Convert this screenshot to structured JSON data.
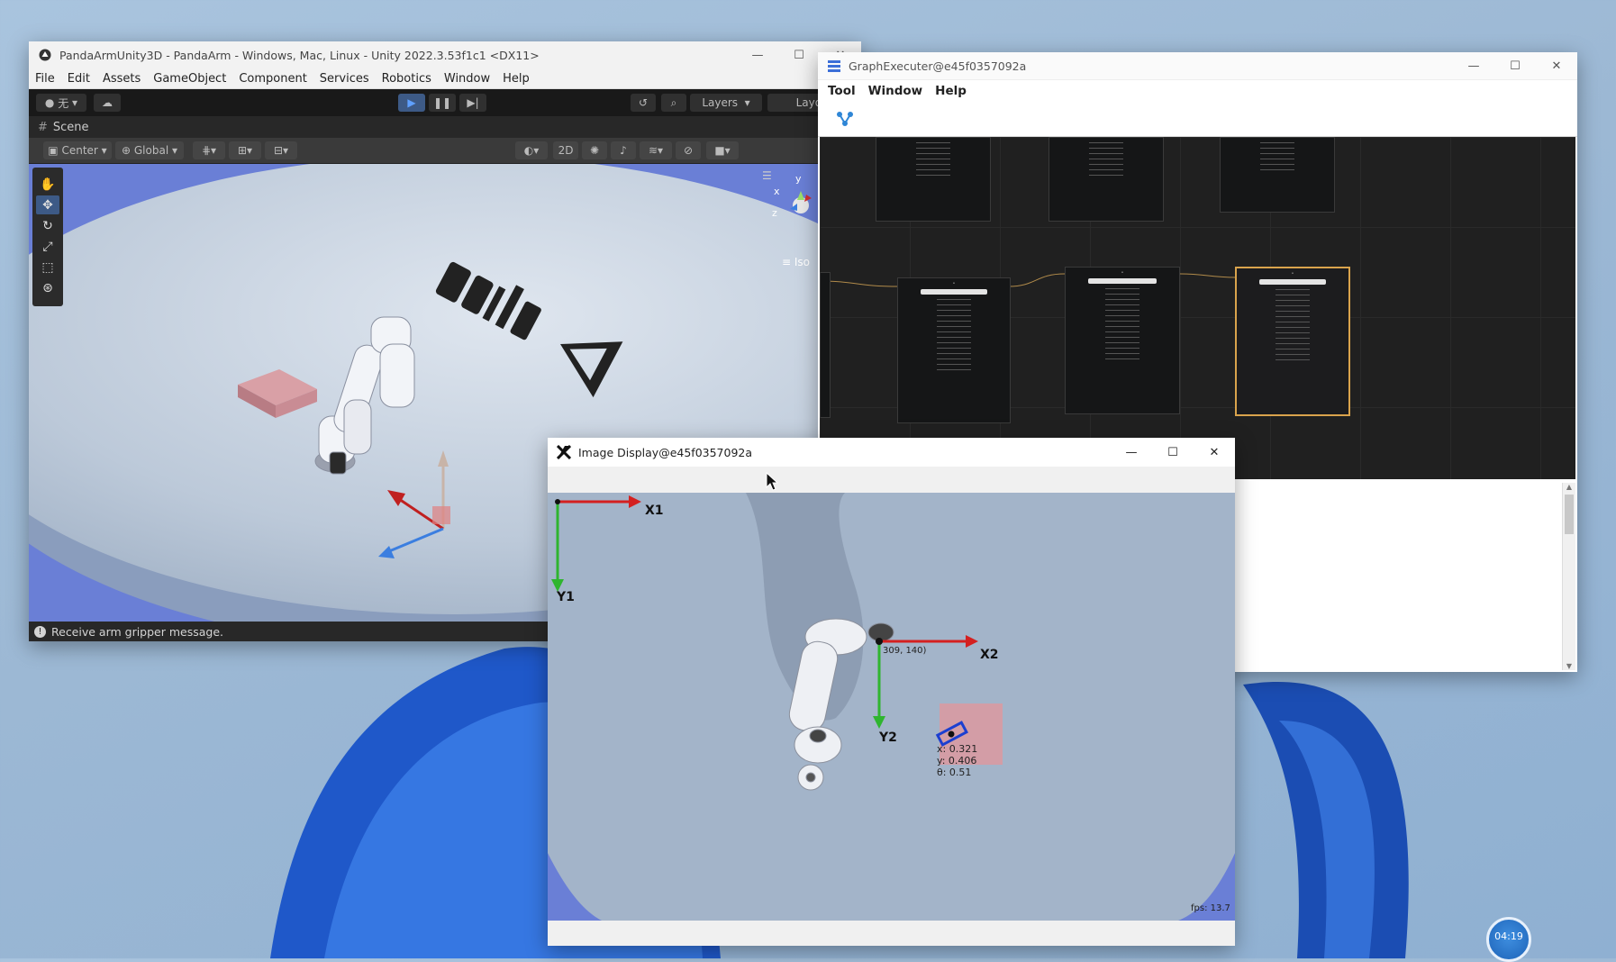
{
  "unity": {
    "title": "PandaArmUnity3D - PandaArm - Windows, Mac, Linux - Unity 2022.3.53f1c1 <DX11>",
    "menu": [
      "File",
      "Edit",
      "Assets",
      "GameObject",
      "Component",
      "Services",
      "Robotics",
      "Window",
      "Help"
    ],
    "account_label": "无",
    "layers_label": "Layers",
    "layout_label": "Layout",
    "scene_tab": "Scene",
    "pivot_label": "Center",
    "space_label": "Global",
    "mode_2d": "2D",
    "iso_label": "Iso",
    "gizmo_axes": {
      "x": "x",
      "y": "y",
      "z": "z"
    },
    "status": "Receive arm gripper message."
  },
  "graph": {
    "title": "GraphExecuter@e45f0357092a",
    "menu": [
      "Tool",
      "Window",
      "Help"
    ]
  },
  "image_display": {
    "title": "Image Display@e45f0357092a",
    "axis_labels": {
      "x1": "X1",
      "y1": "Y1",
      "x2": "X2",
      "y2": "Y2"
    },
    "point_label": "309, 140)",
    "object_info": [
      "x: 0.321",
      "y: 0.406",
      "θ: 0.51"
    ],
    "fps": "fps: 13.7"
  },
  "taskbar": {
    "clock": "04:19"
  },
  "colors": {
    "unity_blue": "#6a7fd6",
    "graph_bg": "#202020",
    "axis_red": "#d42020",
    "axis_green": "#2fb52f",
    "selection": "#d9a34c"
  }
}
